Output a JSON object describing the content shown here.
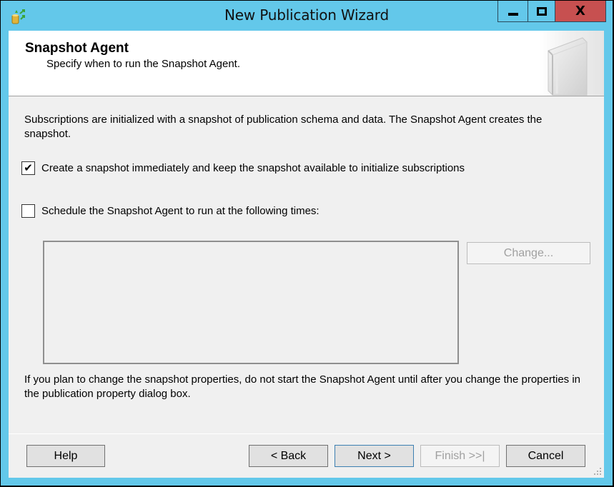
{
  "window": {
    "title": "New Publication Wizard",
    "icon": "replication-database-icon",
    "controls": {
      "minimize": "minimize-icon",
      "maximize": "maximize-icon",
      "close": "close-icon"
    },
    "close_color": "#c75050",
    "frame_color": "#63c8ea"
  },
  "header": {
    "title": "Snapshot Agent",
    "subtitle": "Specify when to run the Snapshot Agent."
  },
  "body": {
    "description": "Subscriptions are initialized with a snapshot of publication schema and data. The Snapshot Agent creates the snapshot.",
    "options": [
      {
        "label": "Create a snapshot immediately and keep the snapshot available to initialize subscriptions",
        "checked": true
      },
      {
        "label": "Schedule the Snapshot Agent to run at the following times:",
        "checked": false
      }
    ],
    "schedule_text": "",
    "change_button": {
      "label": "Change...",
      "enabled": false
    },
    "note": "If you plan to change the snapshot properties, do not start the Snapshot Agent until after you change the properties in the publication property dialog box."
  },
  "footer": {
    "help": "Help",
    "back": "< Back",
    "next": "Next >",
    "finish": "Finish >>|",
    "cancel": "Cancel",
    "finish_enabled": false
  }
}
